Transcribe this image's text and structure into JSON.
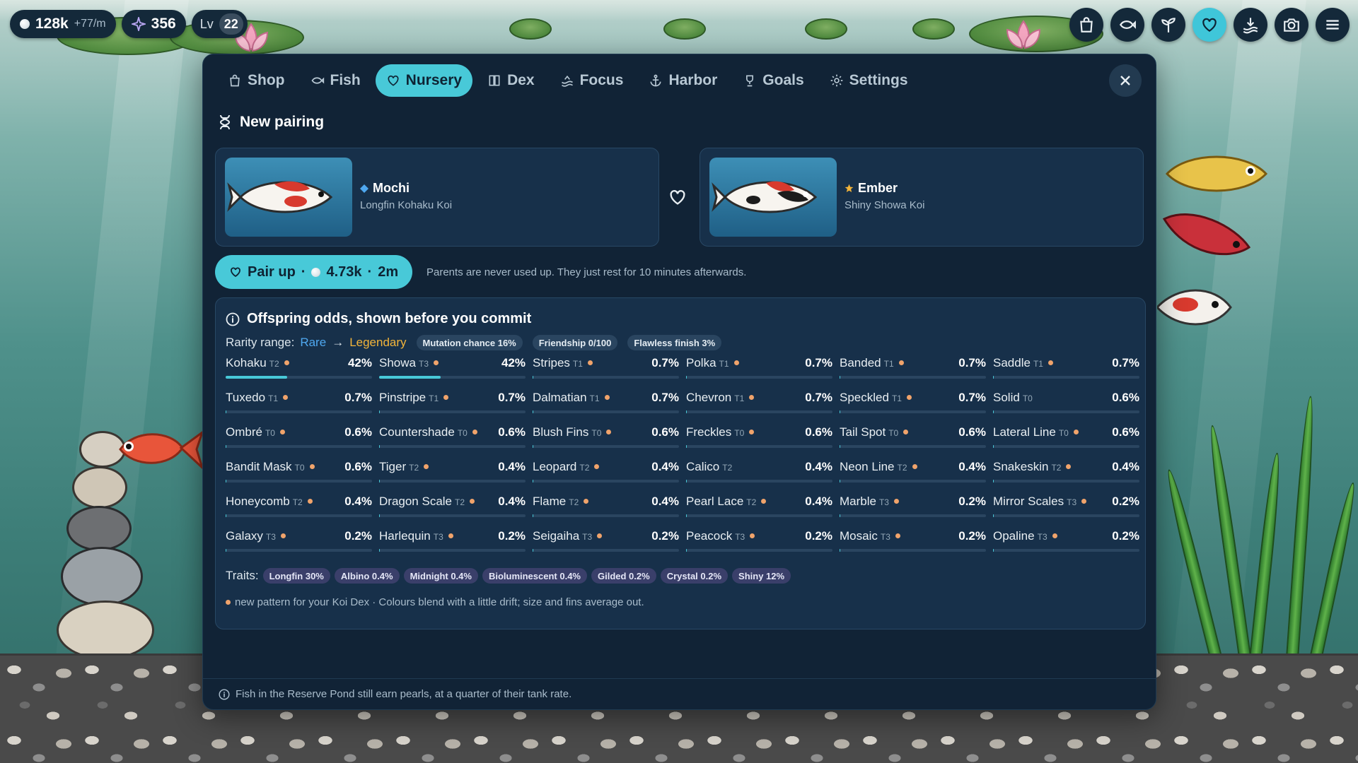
{
  "hud": {
    "pearls": "128k",
    "pearl_rate": "+77/m",
    "stars": "356",
    "level_label": "Lv",
    "level": "22",
    "buttons": [
      {
        "icon": "shopping-bag-icon",
        "active": false
      },
      {
        "icon": "fish-icon",
        "active": false
      },
      {
        "icon": "sprout-icon",
        "active": false
      },
      {
        "icon": "heart-icon",
        "active": true
      },
      {
        "icon": "harbor-icon",
        "active": false
      },
      {
        "icon": "camera-icon",
        "active": false
      },
      {
        "icon": "menu-icon",
        "active": false
      }
    ]
  },
  "tabs": [
    {
      "label": "Shop",
      "icon": "bag-icon",
      "active": false
    },
    {
      "label": "Fish",
      "icon": "fish-icon",
      "active": false
    },
    {
      "label": "Nursery",
      "icon": "heart-icon",
      "active": true
    },
    {
      "label": "Dex",
      "icon": "book-icon",
      "active": false
    },
    {
      "label": "Focus",
      "icon": "waves-icon",
      "active": false
    },
    {
      "label": "Harbor",
      "icon": "anchor-icon",
      "active": false
    },
    {
      "label": "Goals",
      "icon": "trophy-icon",
      "active": false
    },
    {
      "label": "Settings",
      "icon": "gear-icon",
      "active": false
    }
  ],
  "pairing": {
    "title": "New pairing",
    "parent_a": {
      "name": "Mochi",
      "desc": "Longfin Kohaku Koi",
      "badge": "diamond",
      "badge_color": "#4fa8f0"
    },
    "parent_b": {
      "name": "Ember",
      "desc": "Shiny Showa Koi",
      "badge": "star",
      "badge_color": "#f2b43a"
    },
    "pair_button": {
      "label": "Pair up",
      "cost": "4.73k",
      "time": "2m"
    },
    "note": "Parents are never used up. They just rest for 10 minutes afterwards."
  },
  "odds": {
    "title": "Offspring odds, shown before you commit",
    "rarity_label": "Rarity range:",
    "rarity_from": "Rare",
    "rarity_arrow": "→",
    "rarity_to": "Legendary",
    "pills": [
      "Mutation chance 16%",
      "Friendship 0/100",
      "Flawless finish 3%"
    ],
    "patterns": [
      {
        "name": "Kohaku",
        "tier": "T2",
        "new": true,
        "pct": "42%",
        "value": 42
      },
      {
        "name": "Showa",
        "tier": "T3",
        "new": true,
        "pct": "42%",
        "value": 42
      },
      {
        "name": "Stripes",
        "tier": "T1",
        "new": true,
        "pct": "0.7%",
        "value": 0.7
      },
      {
        "name": "Polka",
        "tier": "T1",
        "new": true,
        "pct": "0.7%",
        "value": 0.7
      },
      {
        "name": "Banded",
        "tier": "T1",
        "new": true,
        "pct": "0.7%",
        "value": 0.7
      },
      {
        "name": "Saddle",
        "tier": "T1",
        "new": true,
        "pct": "0.7%",
        "value": 0.7
      },
      {
        "name": "Tuxedo",
        "tier": "T1",
        "new": true,
        "pct": "0.7%",
        "value": 0.7
      },
      {
        "name": "Pinstripe",
        "tier": "T1",
        "new": true,
        "pct": "0.7%",
        "value": 0.7
      },
      {
        "name": "Dalmatian",
        "tier": "T1",
        "new": true,
        "pct": "0.7%",
        "value": 0.7
      },
      {
        "name": "Chevron",
        "tier": "T1",
        "new": true,
        "pct": "0.7%",
        "value": 0.7
      },
      {
        "name": "Speckled",
        "tier": "T1",
        "new": true,
        "pct": "0.7%",
        "value": 0.7
      },
      {
        "name": "Solid",
        "tier": "T0",
        "new": false,
        "pct": "0.6%",
        "value": 0.6
      },
      {
        "name": "Ombré",
        "tier": "T0",
        "new": true,
        "pct": "0.6%",
        "value": 0.6
      },
      {
        "name": "Countershade",
        "tier": "T0",
        "new": true,
        "pct": "0.6%",
        "value": 0.6
      },
      {
        "name": "Blush Fins",
        "tier": "T0",
        "new": true,
        "pct": "0.6%",
        "value": 0.6
      },
      {
        "name": "Freckles",
        "tier": "T0",
        "new": true,
        "pct": "0.6%",
        "value": 0.6
      },
      {
        "name": "Tail Spot",
        "tier": "T0",
        "new": true,
        "pct": "0.6%",
        "value": 0.6
      },
      {
        "name": "Lateral Line",
        "tier": "T0",
        "new": true,
        "pct": "0.6%",
        "value": 0.6
      },
      {
        "name": "Bandit Mask",
        "tier": "T0",
        "new": true,
        "pct": "0.6%",
        "value": 0.6
      },
      {
        "name": "Tiger",
        "tier": "T2",
        "new": true,
        "pct": "0.4%",
        "value": 0.4
      },
      {
        "name": "Leopard",
        "tier": "T2",
        "new": true,
        "pct": "0.4%",
        "value": 0.4
      },
      {
        "name": "Calico",
        "tier": "T2",
        "new": false,
        "pct": "0.4%",
        "value": 0.4
      },
      {
        "name": "Neon Line",
        "tier": "T2",
        "new": true,
        "pct": "0.4%",
        "value": 0.4
      },
      {
        "name": "Snakeskin",
        "tier": "T2",
        "new": true,
        "pct": "0.4%",
        "value": 0.4
      },
      {
        "name": "Honeycomb",
        "tier": "T2",
        "new": true,
        "pct": "0.4%",
        "value": 0.4
      },
      {
        "name": "Dragon Scale",
        "tier": "T2",
        "new": true,
        "pct": "0.4%",
        "value": 0.4
      },
      {
        "name": "Flame",
        "tier": "T2",
        "new": true,
        "pct": "0.4%",
        "value": 0.4
      },
      {
        "name": "Pearl Lace",
        "tier": "T2",
        "new": true,
        "pct": "0.4%",
        "value": 0.4
      },
      {
        "name": "Marble",
        "tier": "T3",
        "new": true,
        "pct": "0.2%",
        "value": 0.2
      },
      {
        "name": "Mirror Scales",
        "tier": "T3",
        "new": true,
        "pct": "0.2%",
        "value": 0.2
      },
      {
        "name": "Galaxy",
        "tier": "T3",
        "new": true,
        "pct": "0.2%",
        "value": 0.2
      },
      {
        "name": "Harlequin",
        "tier": "T3",
        "new": true,
        "pct": "0.2%",
        "value": 0.2
      },
      {
        "name": "Seigaiha",
        "tier": "T3",
        "new": true,
        "pct": "0.2%",
        "value": 0.2
      },
      {
        "name": "Peacock",
        "tier": "T3",
        "new": true,
        "pct": "0.2%",
        "value": 0.2
      },
      {
        "name": "Mosaic",
        "tier": "T3",
        "new": true,
        "pct": "0.2%",
        "value": 0.2
      },
      {
        "name": "Opaline",
        "tier": "T3",
        "new": true,
        "pct": "0.2%",
        "value": 0.2
      }
    ],
    "traits_label": "Traits:",
    "traits": [
      "Longfin 30%",
      "Albino 0.4%",
      "Midnight 0.4%",
      "Bioluminescent 0.4%",
      "Gilded 0.2%",
      "Crystal 0.2%",
      "Shiny 12%"
    ],
    "legend": "new pattern for your Koi Dex · Colours blend with a little drift; size and fins average out."
  },
  "footer": "Fish in the Reserve Pond still earn pearls, at a quarter of their tank rate.",
  "colors": {
    "accent": "#48c9d8",
    "panel": "#112336",
    "rare": "#4fa8f0",
    "legendary": "#f2b43a",
    "new_dot": "#f0a36b"
  }
}
